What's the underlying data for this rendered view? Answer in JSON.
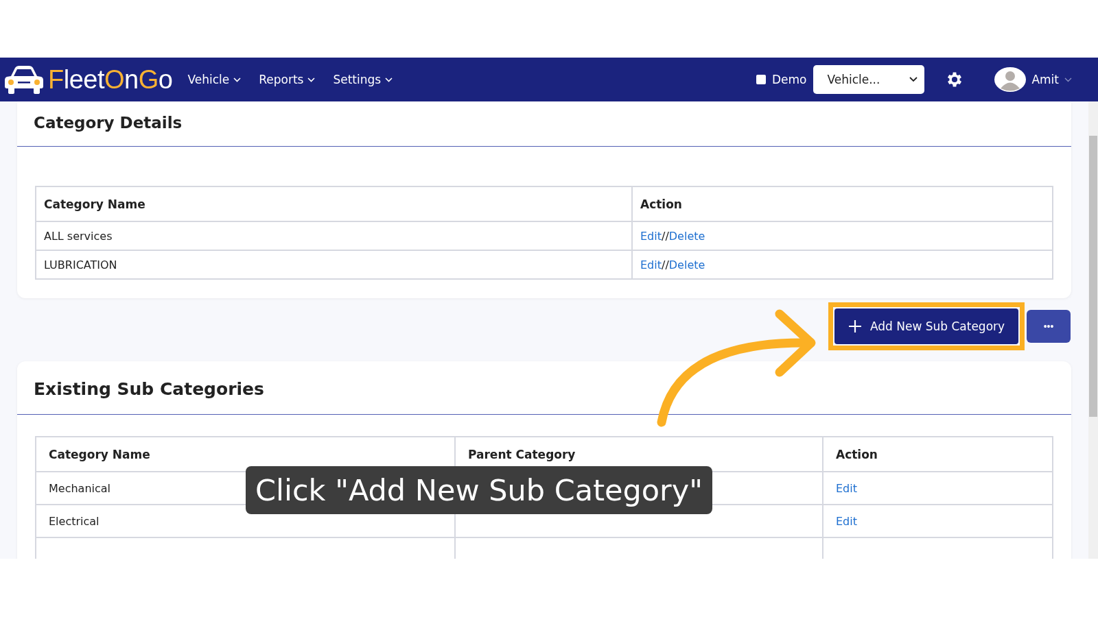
{
  "navbar": {
    "logo": [
      {
        "text": "F",
        "accent": true
      },
      {
        "text": "leet",
        "accent": false
      },
      {
        "text": "O",
        "accent": true
      },
      {
        "text": "n",
        "accent": false
      },
      {
        "text": "G",
        "accent": true
      },
      {
        "text": "o",
        "accent": false
      }
    ],
    "menus": [
      {
        "label": "Vehicle"
      },
      {
        "label": "Reports"
      },
      {
        "label": "Settings"
      }
    ],
    "demo": {
      "label": "Demo",
      "checked": false
    },
    "vehicle_select": {
      "value": "Vehicle..."
    },
    "user": {
      "name": "Amit"
    }
  },
  "category_details": {
    "title": "Category Details",
    "columns": [
      "Category Name",
      "Action"
    ],
    "rows": [
      {
        "name": "ALL services",
        "actions": [
          {
            "kind": "link",
            "label": "Edit"
          },
          {
            "kind": "text",
            "label": "//"
          },
          {
            "kind": "link",
            "label": "Delete"
          }
        ]
      },
      {
        "name": "LUBRICATION",
        "actions": [
          {
            "kind": "link",
            "label": "Edit"
          },
          {
            "kind": "text",
            "label": "//"
          },
          {
            "kind": "link",
            "label": "Delete"
          }
        ]
      }
    ]
  },
  "add_button": {
    "label": "Add New Sub Category"
  },
  "more_button": {
    "label": "•••"
  },
  "existing_sub_categories": {
    "title": "Existing Sub Categories",
    "columns": [
      "Category Name",
      "Parent Category",
      "Action"
    ],
    "rows": [
      {
        "cells": [
          "Mechanical",
          ""
        ],
        "action": "Edit"
      },
      {
        "cells": [
          "Electrical",
          ""
        ],
        "action": "Edit"
      }
    ]
  },
  "caption": {
    "text": "Click \"Add New Sub Category\""
  }
}
